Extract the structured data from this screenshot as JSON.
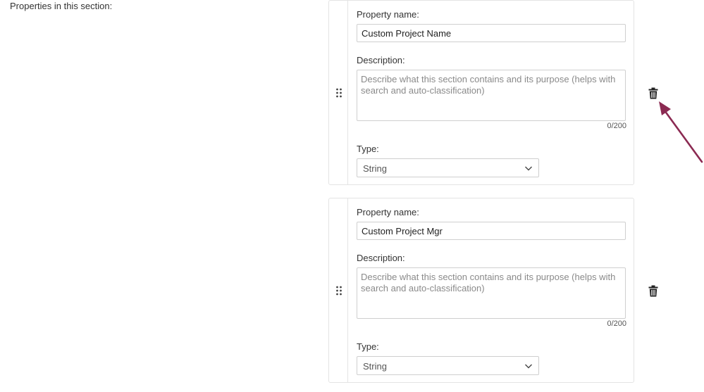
{
  "section": {
    "label": "Properties in this section:"
  },
  "properties": [
    {
      "name_label": "Property name:",
      "name_value": "Custom Project Name",
      "description_label": "Description:",
      "description_placeholder": "Describe what this section contains and its purpose (helps with search and auto-classification)",
      "char_count": "0/200",
      "type_label": "Type:",
      "type_value": "String"
    },
    {
      "name_label": "Property name:",
      "name_value": "Custom Project Mgr",
      "description_label": "Description:",
      "description_placeholder": "Describe what this section contains and its purpose (helps with search and auto-classification)",
      "char_count": "0/200",
      "type_label": "Type:",
      "type_value": "String"
    }
  ],
  "icons": {
    "drag": "drag-handle-icon",
    "delete": "trash-icon",
    "dropdown": "chevron-down-icon"
  },
  "colors": {
    "annotation_arrow": "#8b2a52"
  }
}
